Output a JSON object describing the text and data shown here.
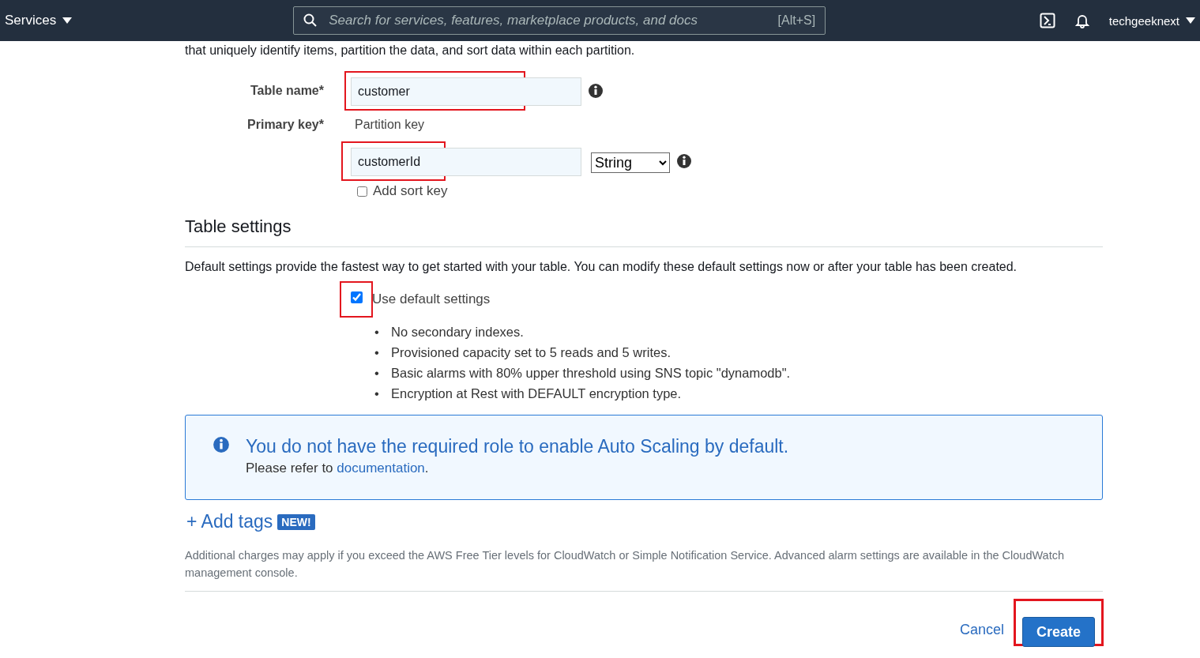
{
  "top_bar": {
    "services": "Services",
    "search_placeholder": "Search for services, features, marketplace products, and docs",
    "shortcut": "[Alt+S]",
    "user": "techgeeknext"
  },
  "intro": "that uniquely identify items, partition the data, and sort data within each partition.",
  "form": {
    "table_name_label": "Table name*",
    "table_name": "customer",
    "table_name_highlighted": true,
    "primary_key_label": "Primary key*",
    "partition_label": "Partition key",
    "partition_key": "customerId",
    "partition_highlighted": true,
    "key_type": "String",
    "sort_key": {
      "label": "Add sort key",
      "checked": false
    }
  },
  "settings": {
    "title": "Table settings",
    "description": "Default settings provide the fastest way to get started with your table. You can modify these default settings now or after your table has been created.",
    "use_default": {
      "label": "Use default settings",
      "checked": true,
      "highlighted": true
    },
    "bullet_marker": "•",
    "bullets": [
      "No secondary indexes.",
      "Provisioned capacity set to 5 reads and 5 writes.",
      "Basic alarms with 80% upper threshold using SNS topic \"dynamodb\".",
      "Encryption at Rest with DEFAULT encryption type."
    ]
  },
  "alert": {
    "title": "You do not have the required role to enable Auto Scaling by default.",
    "text": "Please refer to",
    "link": "documentation",
    "end": "."
  },
  "add_tags": {
    "label": "+ Add tags",
    "badge": "NEW!"
  },
  "note": "Additional charges may apply if you exceed the AWS Free Tier levels for CloudWatch or Simple Notification Service. Advanced alarm settings are available in the CloudWatch management console.",
  "buttons": {
    "cancel": "Cancel",
    "create": "Create",
    "create_highlighted": true
  }
}
